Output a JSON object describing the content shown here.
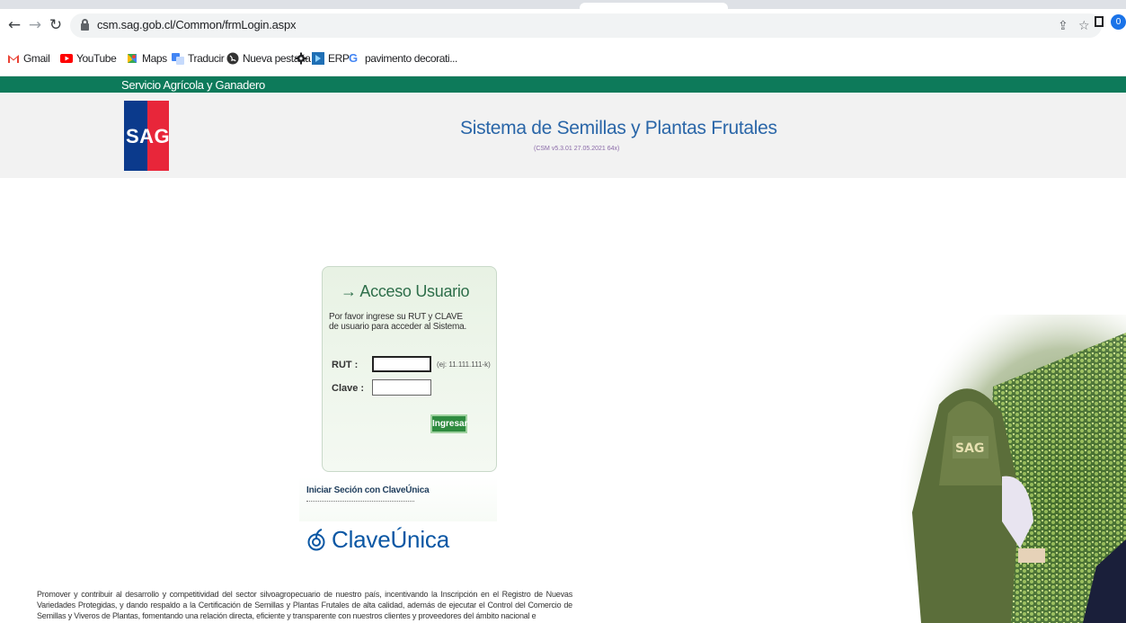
{
  "browser": {
    "url": "csm.sag.gob.cl/Common/frmLogin.aspx",
    "profile_count": "0",
    "bookmarks": [
      "Gmail",
      "YouTube",
      "Maps",
      "Traducir",
      "Nueva pestaña",
      "ERP",
      "pavimento decorati..."
    ]
  },
  "page": {
    "org_name": "Servicio Agrícola y Ganadero",
    "logo_text": "SAG",
    "system_title": "Sistema de Semillas y Plantas Frutales",
    "version": "(CSM v5.3.01 27.05.2021 64x)"
  },
  "login": {
    "title": "→ Acceso Usuario",
    "instructions_line1": "Por favor ingrese su RUT y CLAVE",
    "instructions_line2": "de usuario para acceder al Sistema.",
    "rut_label": "RUT  :",
    "rut_value": "",
    "rut_hint": "(ej: 11.111.111-k)",
    "clave_label": "Clave :",
    "clave_value": "",
    "submit_label": "Ingresar"
  },
  "claveunica": {
    "link_text": "Iniciar Seción con ClaveÚnica",
    "logo_word_a": "Clave",
    "logo_word_b": "Única"
  },
  "footer": {
    "mission_text": "Promover y contribuir al desarrollo y competitividad del sector silvoagropecuario de nuestro país, incentivando la Inscripción en el Registro de Nuevas Variedades Protegidas, y dando respaldo a la Certificación de Semillas y Plantas Frutales de alta calidad, además de ejecutar el Control del Comercio de Semillas y Viveros de Plantas, fomentando una relación directa, eficiente y transparente con nuestros clientes y proveedores del ámbito nacional e"
  },
  "colors": {
    "brand_green": "#0d7a5a",
    "title_blue": "#2a66a8",
    "sag_blue": "#0b3a8c",
    "sag_red": "#e8263a",
    "button_green": "#2e8b3f"
  }
}
